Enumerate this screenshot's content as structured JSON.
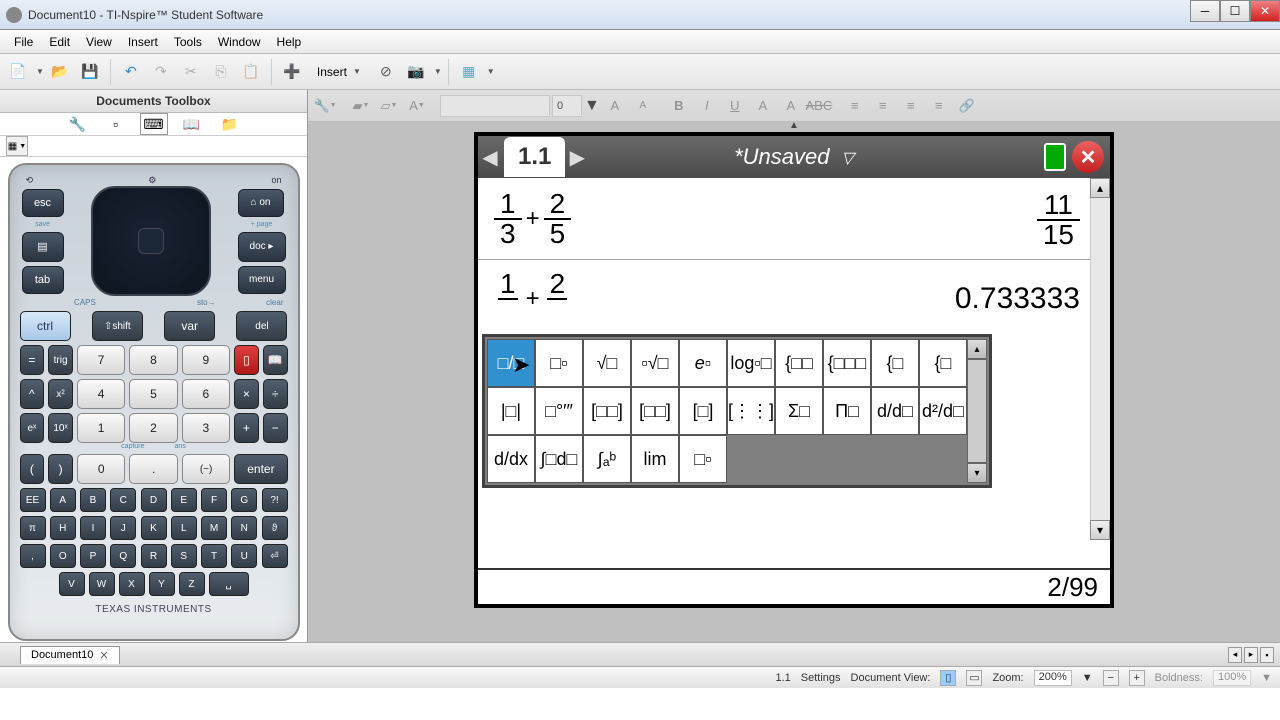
{
  "window": {
    "title": "Document10 - TI-Nspire™ Student Software"
  },
  "menu": [
    "File",
    "Edit",
    "View",
    "Insert",
    "Tools",
    "Window",
    "Help"
  ],
  "toolbar": {
    "insert_label": "Insert"
  },
  "format": {
    "font_size": "0"
  },
  "sidebar": {
    "title": "Documents Toolbox"
  },
  "calculator": {
    "top_left": "⟲",
    "top_right": "on",
    "esc": "esc",
    "home_on": "⌂ on",
    "save": "save",
    "page": "+ page",
    "doc": "doc ▸",
    "tab": "tab",
    "menu": "menu",
    "caps": "CAPS",
    "sto": "sto→",
    "clear": "clear",
    "ctrl": "ctrl",
    "shift": "⇧shift",
    "var": "var",
    "del": "del",
    "trig": "trig",
    "labels_row1": [
      "",
      "",
      "",
      "π",
      ""
    ],
    "capture": "capture",
    "ans": "ans",
    "enter": "enter",
    "logo": "TEXAS INSTRUMENTS",
    "numbers": {
      "7": "7",
      "8": "8",
      "9": "9",
      "4": "4",
      "5": "5",
      "6": "6",
      "1": "1",
      "2": "2",
      "3": "3",
      "0": "0"
    },
    "ops": {
      "eq": "=",
      "times": "×",
      "div": "÷",
      "plus": "+",
      "minus": "−",
      "caret": "^",
      "x2": "x²",
      "ex": "eˣ",
      "tenx": "10ˣ",
      "lparen": "(",
      "rparen": ")",
      "dot": ".",
      "neg": "(−)"
    },
    "letters_row1": [
      "EE",
      "A",
      "B",
      "C",
      "D",
      "E",
      "F",
      "G",
      "?!"
    ],
    "letters_row2": [
      "π",
      "H",
      "I",
      "J",
      "K",
      "L",
      "M",
      "N",
      "ϑ"
    ],
    "letters_row3": [
      ",",
      "O",
      "P",
      "Q",
      "R",
      "S",
      "T",
      "U",
      "⏎"
    ],
    "letters_row4": [
      "V",
      "W",
      "X",
      "Y",
      "Z"
    ]
  },
  "handheld": {
    "tab": "1.1",
    "doc_name": "*Unsaved",
    "page_indicator": "2/99",
    "lines": [
      {
        "expr_frac1_num": "1",
        "expr_frac1_den": "3",
        "expr_frac2_num": "2",
        "expr_frac2_den": "5",
        "result_num": "11",
        "result_den": "15"
      },
      {
        "expr_frac1_num": "1",
        "expr_frac1_den": "",
        "expr_frac2_num": "2",
        "expr_frac2_den": "",
        "result_plain": "0.733333"
      }
    ]
  },
  "palette_templates": {
    "row1": [
      "fraction",
      "exponent",
      "sqrt",
      "nth-root",
      "e-power",
      "log-base",
      "piecewise-2",
      "piecewise-3",
      "system-2",
      "system-n"
    ],
    "row2": [
      "abs",
      "dms",
      "matrix-2x2",
      "matrix-1x2",
      "matrix-2x1",
      "matrix-mxn",
      "sum",
      "product",
      "derivative-n",
      "second-derivative"
    ],
    "row3": [
      "derivative",
      "integral",
      "definite-integral",
      "limit",
      "subscript",
      "",
      "",
      "",
      "",
      ""
    ]
  },
  "palette_glyphs": {
    "row1": [
      "□/□",
      "□▫",
      "√□",
      "▫√□",
      "e▫",
      "log▫□",
      "{□□",
      "{□□□",
      "{□",
      "{□"
    ],
    "row2": [
      "|□|",
      "□°′″",
      "[□□]",
      "[□□]",
      "[□]",
      "[⋮⋮]",
      "Σ□",
      "Π□",
      "d/d□",
      "d²/d□"
    ],
    "row3": [
      "d/dx",
      "∫□d□",
      "∫ₐᵇ",
      "lim",
      "□▫",
      "",
      "",
      "",
      "",
      ""
    ]
  },
  "doc_tabs": {
    "name": "Document10"
  },
  "status": {
    "page": "1.1",
    "settings": "Settings",
    "view_label": "Document View:",
    "zoom_label": "Zoom:",
    "zoom_val": "200%",
    "boldness_label": "Boldness:",
    "boldness_val": "100%"
  }
}
